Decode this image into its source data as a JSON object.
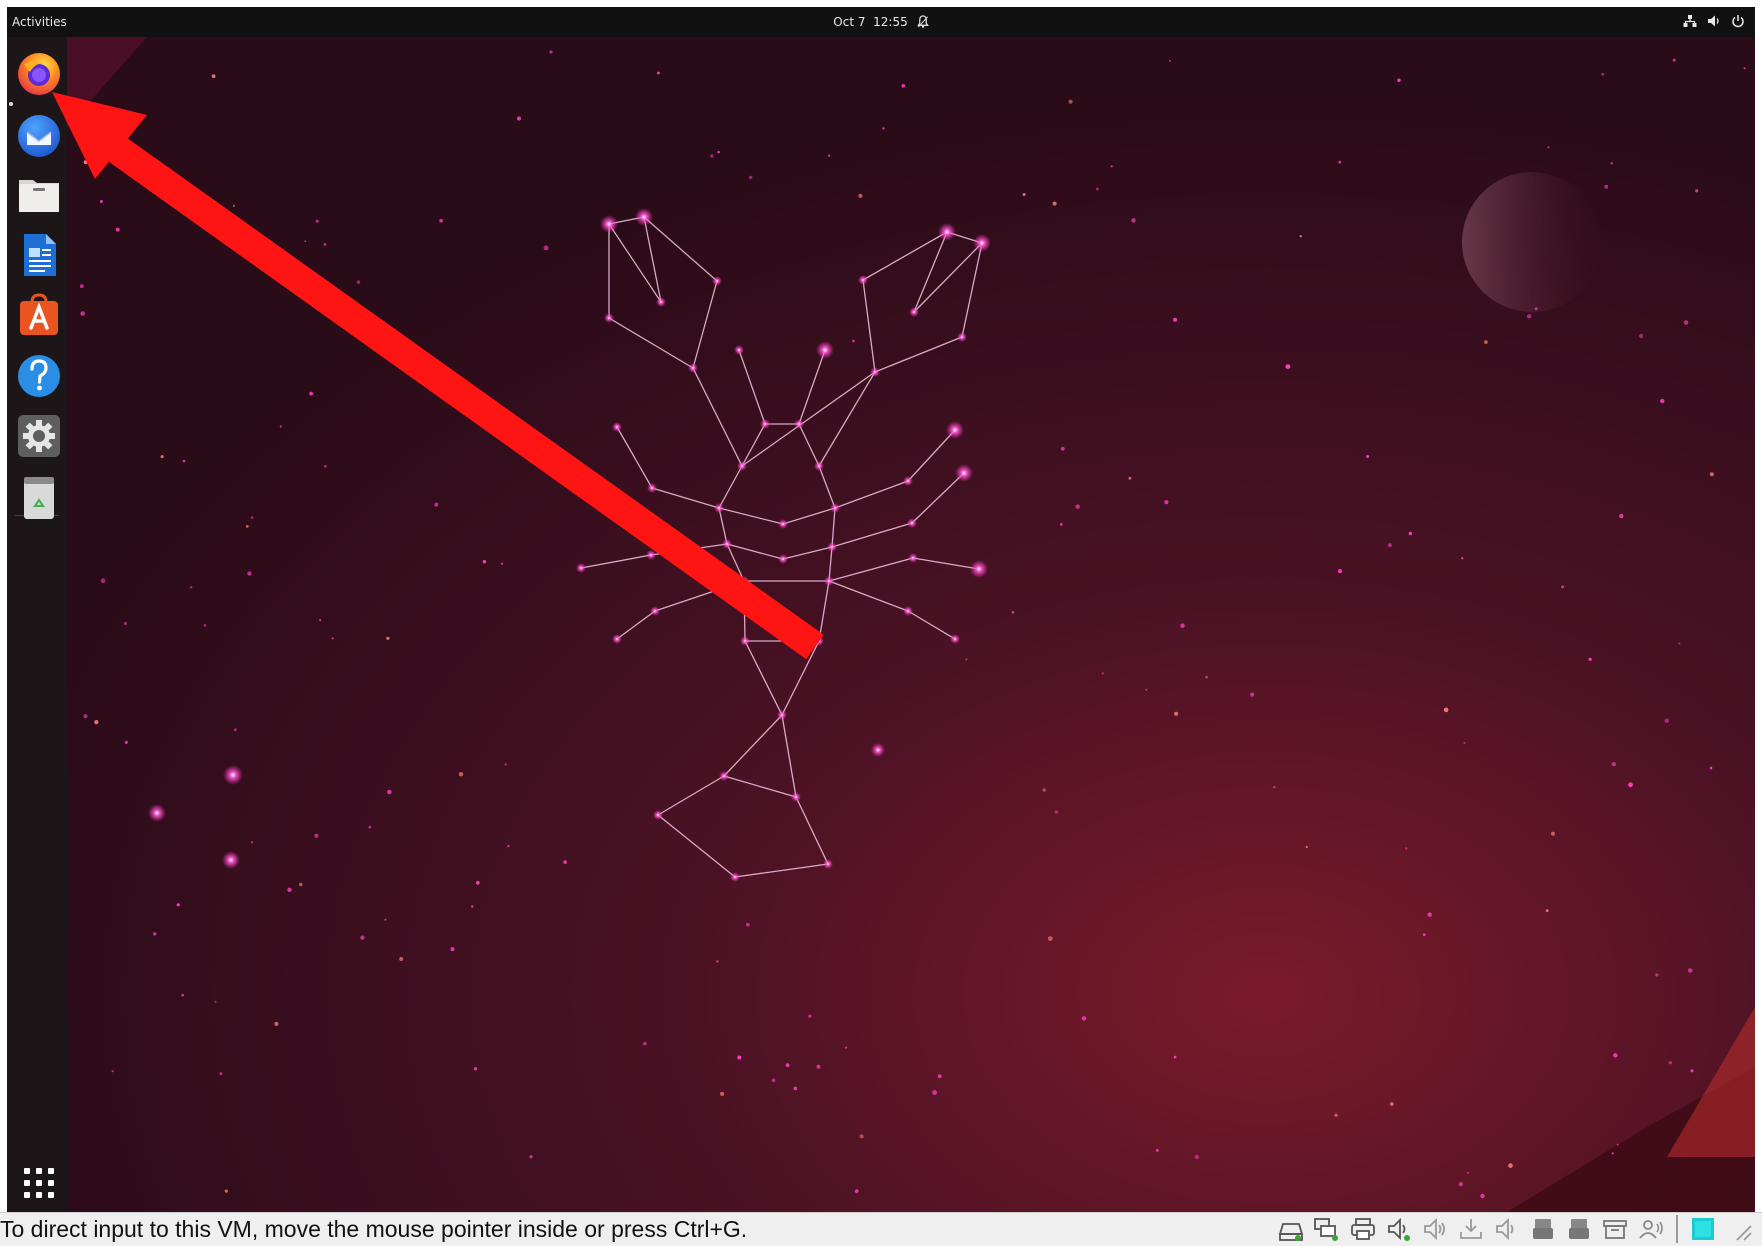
{
  "top_bar": {
    "activities": "Activities",
    "date": "Oct 7",
    "time": "12:55"
  },
  "dock": {
    "items": [
      {
        "name": "firefox",
        "icon": "firefox-icon"
      },
      {
        "name": "thunderbird",
        "icon": "thunderbird-icon"
      },
      {
        "name": "files",
        "icon": "files-icon"
      },
      {
        "name": "libreoffice-writer",
        "icon": "writer-icon"
      },
      {
        "name": "app-center",
        "icon": "app-store-icon"
      },
      {
        "name": "help",
        "icon": "help-icon",
        "glyph": "?"
      },
      {
        "name": "settings",
        "icon": "gear-icon"
      },
      {
        "name": "trash",
        "icon": "trash-icon"
      },
      {
        "name": "show-apps",
        "icon": "app-grid-icon"
      }
    ]
  },
  "annotation": {
    "type": "red-arrow",
    "color": "#ff1414"
  },
  "vm_statusbar": {
    "hint": "To direct input to this VM, move the mouse pointer inside or press Ctrl+G."
  },
  "colors": {
    "wallpaper_dark": "#2e0c1a",
    "wallpaper_mid": "#4a1024",
    "wallpaper_accent": "#b4242a",
    "star": "#ff4fc9",
    "topbar": "#111111",
    "dock": "#1c1618"
  }
}
